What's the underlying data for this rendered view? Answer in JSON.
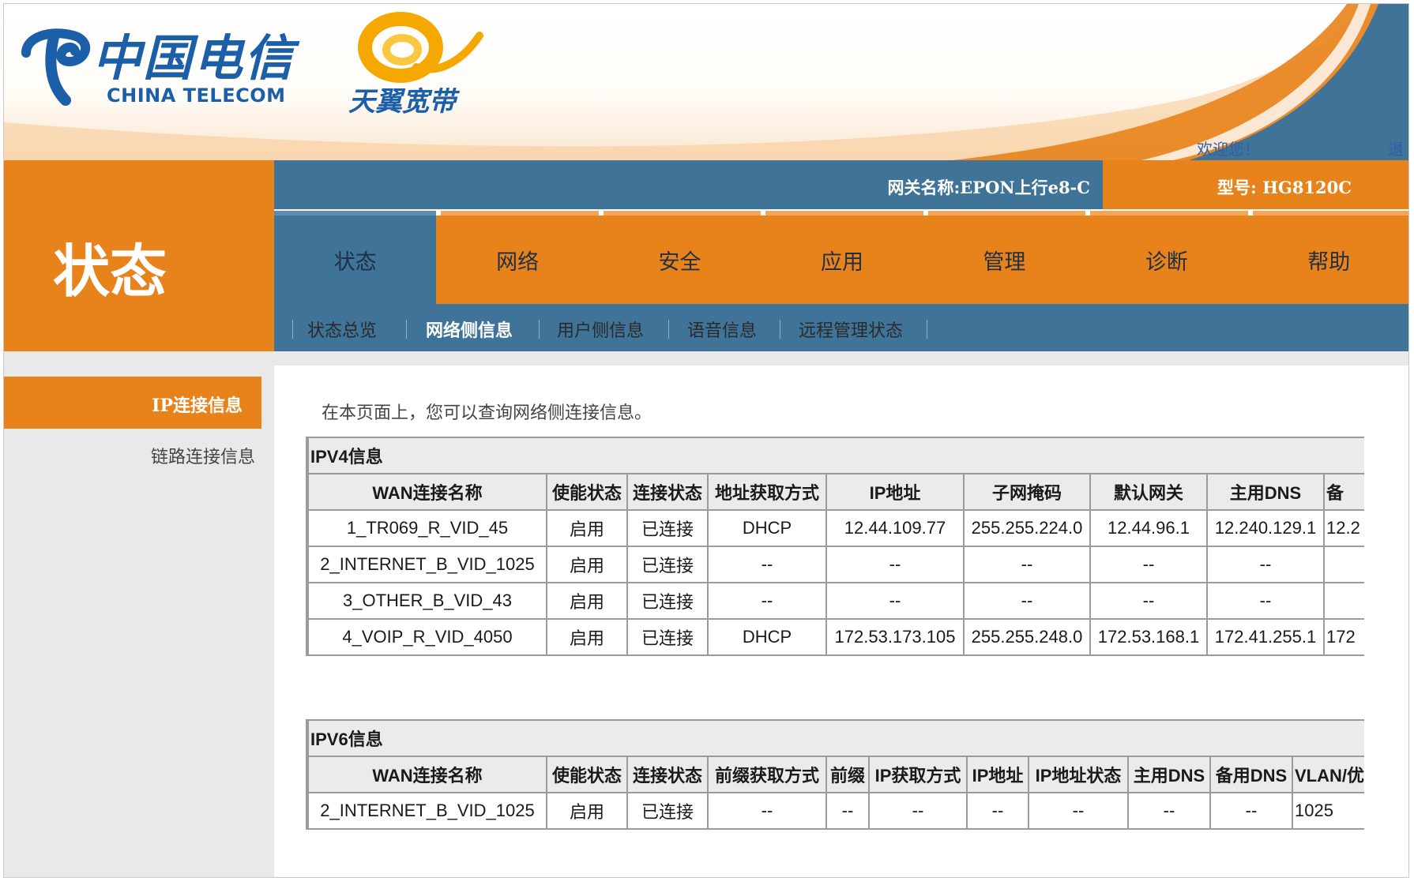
{
  "header": {
    "ct_chars": "中国电信",
    "ct_en": "CHINA TELECOM",
    "ty_text": "天翼宽带",
    "welcome": "欢迎您！",
    "logout": "退出",
    "gateway_name": "网关名称:EPON上行e8-C",
    "model": "型号: HG8120C"
  },
  "section_title": "状态",
  "main_tabs": [
    "状态",
    "网络",
    "安全",
    "应用",
    "管理",
    "诊断",
    "帮助"
  ],
  "sub_tabs": [
    "状态总览",
    "网络侧信息",
    "用户侧信息",
    "语音信息",
    "远程管理状态"
  ],
  "sidebar": {
    "items": [
      "IP连接信息",
      "链路连接信息"
    ]
  },
  "intro": "在本页面上，您可以查询网络侧连接信息。",
  "ipv4": {
    "title": "IPV4信息",
    "headers": [
      "WAN连接名称",
      "使能状态",
      "连接状态",
      "地址获取方式",
      "IP地址",
      "子网掩码",
      "默认网关",
      "主用DNS",
      "备"
    ],
    "rows": [
      [
        "1_TR069_R_VID_45",
        "启用",
        "已连接",
        "DHCP",
        "12.44.109.77",
        "255.255.224.0",
        "12.44.96.1",
        "12.240.129.1",
        "12.2"
      ],
      [
        "2_INTERNET_B_VID_1025",
        "启用",
        "已连接",
        "--",
        "--",
        "--",
        "--",
        "--",
        ""
      ],
      [
        "3_OTHER_B_VID_43",
        "启用",
        "已连接",
        "--",
        "--",
        "--",
        "--",
        "--",
        ""
      ],
      [
        "4_VOIP_R_VID_4050",
        "启用",
        "已连接",
        "DHCP",
        "172.53.173.105",
        "255.255.248.0",
        "172.53.168.1",
        "172.41.255.1",
        "172"
      ]
    ]
  },
  "ipv6": {
    "title": "IPV6信息",
    "headers": [
      "WAN连接名称",
      "使能状态",
      "连接状态",
      "前缀获取方式",
      "前缀",
      "IP获取方式",
      "IP地址",
      "IP地址状态",
      "主用DNS",
      "备用DNS",
      "VLAN/优"
    ],
    "rows": [
      [
        "2_INTERNET_B_VID_1025",
        "启用",
        "已连接",
        "--",
        "--",
        "--",
        "--",
        "--",
        "--",
        "--",
        "1025"
      ]
    ]
  },
  "colors": {
    "orange": "#e8831b",
    "steel_blue": "#3f7397",
    "table_header_bg": "#ebebeb",
    "sidebar_bg": "#e9e9e9"
  }
}
